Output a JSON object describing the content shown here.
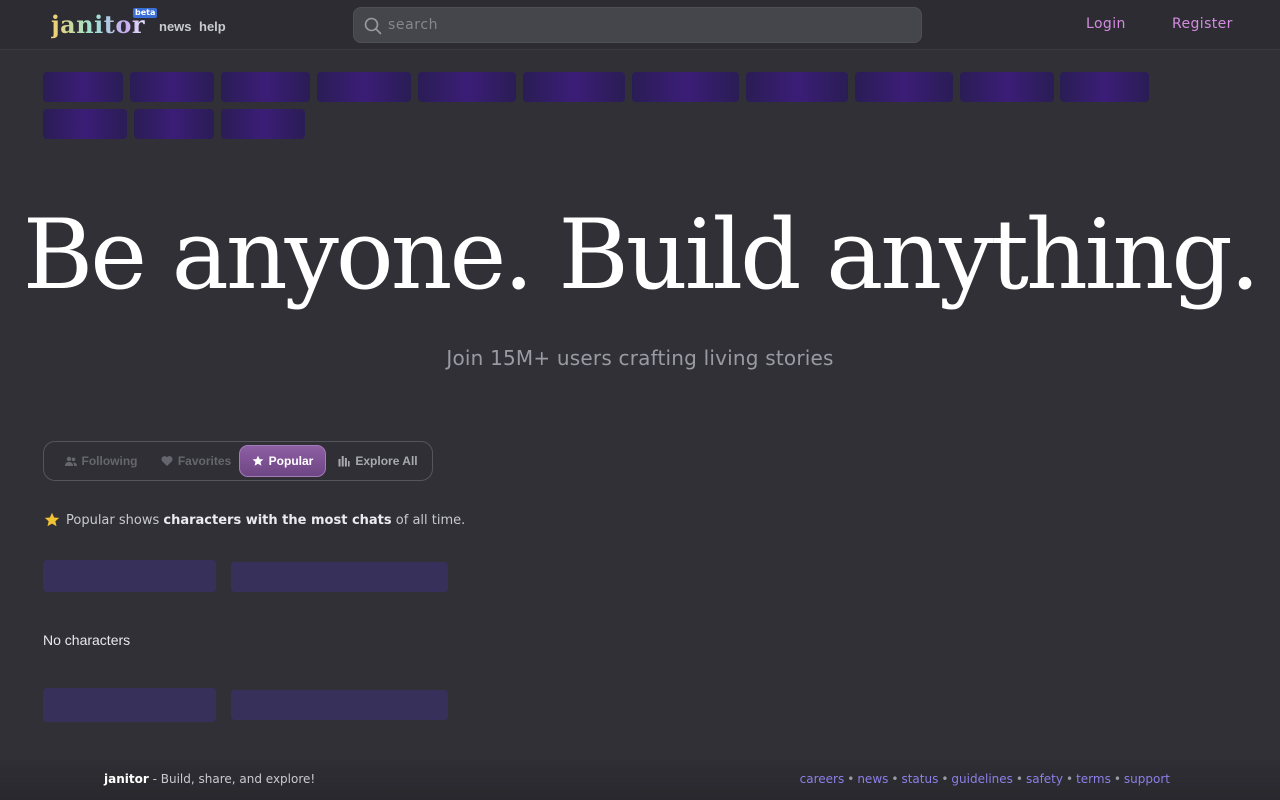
{
  "header": {
    "logo": "janitor",
    "beta": "beta",
    "nav": [
      "news",
      "help"
    ],
    "search_placeholder": "search",
    "login": "Login",
    "register": "Register"
  },
  "hero": {
    "title": "Be anyone. Build anything.",
    "subtitle": "Join 15M+ users crafting living stories"
  },
  "tabs": [
    {
      "label": "Following",
      "icon": "users-icon",
      "active": false
    },
    {
      "label": "Favorites",
      "icon": "heart-icon",
      "active": false
    },
    {
      "label": "Popular",
      "icon": "star-icon",
      "active": true
    },
    {
      "label": "Explore All",
      "icon": "bar-chart-icon",
      "active": false
    }
  ],
  "info": {
    "prefix": "Popular shows",
    "bold": "characters with the most chats",
    "suffix": "of all time."
  },
  "empty_state": "No characters",
  "footer": {
    "brand": "janitor",
    "tagline": "- Build, share, and explore!",
    "links": [
      "careers",
      "news",
      "status",
      "guidelines",
      "safety",
      "terms",
      "support"
    ]
  },
  "colors": {
    "background": "#303036",
    "accent": "#d48be0",
    "tab_active": "#8d5ea3",
    "footer_link": "#8d7fe8"
  }
}
